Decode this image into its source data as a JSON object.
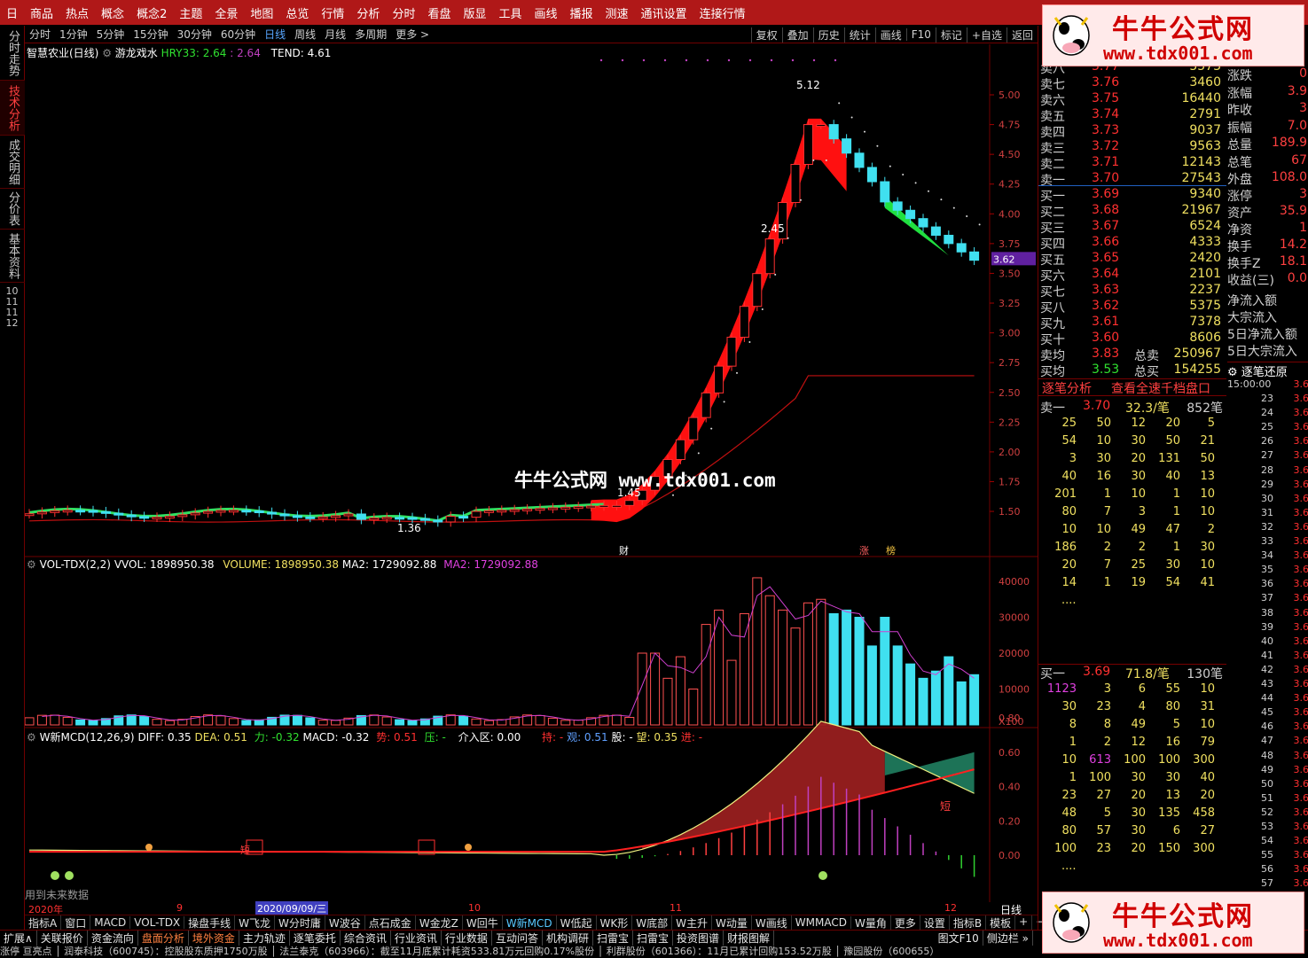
{
  "menu": [
    "日",
    "商品",
    "热点",
    "概念",
    "概念2",
    "主题",
    "全景",
    "地图",
    "总览",
    "行情",
    "分析",
    "分时",
    "看盘",
    "版显",
    "工具",
    "画线",
    "播报",
    "测速",
    "通讯设置",
    "连接行情"
  ],
  "periods": [
    "分时",
    "1分钟",
    "5分钟",
    "15分钟",
    "30分钟",
    "60分钟",
    "日线",
    "周线",
    "月线",
    "多周期",
    "更多 >"
  ],
  "period_active": "日线",
  "right_tools": [
    "复权",
    "叠加",
    "历史",
    "统计",
    "画线",
    "F10",
    "标记",
    "+自选",
    "返回"
  ],
  "left_tabs": [
    "分时走势",
    "技术分析",
    "成交明细",
    "分价表",
    "基本资料"
  ],
  "left_tab_active": "技术分析",
  "left_bottom_nums": [
    "10",
    "11",
    "11",
    "12"
  ],
  "main_legend": {
    "stock": "智慧农业(日线)",
    "indicator": "游龙戏水",
    "hry_label": "HRY33: 2.64",
    "hry_val2": "2.64",
    "tend": "TEND: 4.61"
  },
  "price_axis": [
    "5.00",
    "4.75",
    "4.50",
    "4.25",
    "4.00",
    "3.75",
    "3.50",
    "3.25",
    "3.00",
    "2.75",
    "2.50",
    "2.25",
    "2.00",
    "1.75",
    "1.50"
  ],
  "price_tag": "3.62",
  "annotations": {
    "high": "5.12",
    "low": "1.36",
    "mid1": "2.45",
    "mid2": "1.45",
    "cai": "财",
    "zhang": "涨",
    "bang": "榜"
  },
  "vol_legend": {
    "name": "VOL-TDX(2,2)",
    "vvol": "VVOL: 1898950.38",
    "volume": "VOLUME: 1898950.38",
    "ma2": "MA2: 1729092.88",
    "ma2b": "MA2: 1729092.88"
  },
  "vol_axis": [
    "40000",
    "30000",
    "20000",
    "10000",
    "X100"
  ],
  "macd_legend": {
    "name": "W新MCD(12,26,9)",
    "diff": "DIFF: 0.35",
    "dea": "DEA: 0.51",
    "li": "力: -0.32",
    "macd": "MACD: -0.32",
    "shi": "势: 0.51",
    "ya": "压: -",
    "jieru": "介入区: 0.00",
    "chi": "持: -",
    "guan": "观: 0.51",
    "gu": "股: -",
    "wang": "望: 0.35",
    "jin": "进: -"
  },
  "macd_axis": [
    "0.80",
    "0.60",
    "0.40",
    "0.20",
    "0.00"
  ],
  "macd_note": "用到未来数据",
  "macd_marks": {
    "duan": "短",
    "duan2": "短"
  },
  "date_axis": {
    "d2020": "2020年",
    "m9": "9",
    "cursor": "2020/09/09/三",
    "m10": "10",
    "m11": "11",
    "m12": "12",
    "period": "日线"
  },
  "center_watermark": "牛牛公式网 www.tdx001.com",
  "watermark": {
    "title": "牛牛公式网",
    "url": "www.tdx001.com"
  },
  "ind_tabs": [
    "指标A",
    "窗口",
    "MACD",
    "VOL-TDX",
    "操盘手线",
    "W飞龙",
    "W分时庸",
    "W波谷",
    "点石成金",
    "W金龙Z",
    "W回牛",
    "W新MCD",
    "W低起",
    "WK形",
    "W底部",
    "W主升",
    "W动量",
    "W画线",
    "WMMACD",
    "W量角",
    "更多",
    "设置"
  ],
  "ind_tab_active": "W新MCD",
  "ind_right": [
    "指标B",
    "模板",
    "+",
    "−"
  ],
  "bottom_tabs": [
    "扩展∧",
    "关联报价",
    "资金流向",
    "盘面分析",
    "境外资金",
    "主力轨迹",
    "逐笔委托",
    "综合资讯",
    "行业资讯",
    "行业数据",
    "互动问答",
    "机构调研",
    "扫雷宝",
    "扫雷宝",
    "投资图谱",
    "财报图解"
  ],
  "bottom_right": [
    "图文F10",
    "侧边栏 »"
  ],
  "ticker": "涨停 亘亮点 │ 润泰科技（600745）：控股股东质押1750万股 │ 法兰泰克（603966）：截至11月底累计耗资533.81万元回购0.17%股份 │ 利群股份（601366）：11月已累计回购153.52万股 │ 豫园股份（600655）",
  "order_book": {
    "asks": [
      {
        "label": "卖八",
        "price": "3.77",
        "vol": "5573"
      },
      {
        "label": "卖七",
        "price": "3.76",
        "vol": "3460"
      },
      {
        "label": "卖六",
        "price": "3.75",
        "vol": "16440"
      },
      {
        "label": "卖五",
        "price": "3.74",
        "vol": "2791"
      },
      {
        "label": "卖四",
        "price": "3.73",
        "vol": "9037"
      },
      {
        "label": "卖三",
        "price": "3.72",
        "vol": "9563"
      },
      {
        "label": "卖二",
        "price": "3.71",
        "vol": "12143"
      },
      {
        "label": "卖一",
        "price": "3.70",
        "vol": "27543"
      }
    ],
    "bids": [
      {
        "label": "买一",
        "price": "3.69",
        "vol": "9340"
      },
      {
        "label": "买二",
        "price": "3.68",
        "vol": "21967"
      },
      {
        "label": "买三",
        "price": "3.67",
        "vol": "6524"
      },
      {
        "label": "买四",
        "price": "3.66",
        "vol": "4333"
      },
      {
        "label": "买五",
        "price": "3.65",
        "vol": "2420"
      },
      {
        "label": "买六",
        "price": "3.64",
        "vol": "2101"
      },
      {
        "label": "买七",
        "price": "3.63",
        "vol": "2237"
      },
      {
        "label": "买八",
        "price": "3.62",
        "vol": "5375"
      },
      {
        "label": "买九",
        "price": "3.61",
        "vol": "7378"
      },
      {
        "label": "买十",
        "price": "3.60",
        "vol": "8606"
      }
    ],
    "avg_ask_label": "卖均",
    "avg_ask": "3.83",
    "total_ask_label": "总卖",
    "total_ask": "250967",
    "avg_bid_label": "买均",
    "avg_bid": "3.53",
    "total_bid_label": "总买",
    "total_bid": "154255"
  },
  "stats": [
    {
      "label": "涨跌",
      "value": "0"
    },
    {
      "label": "涨幅",
      "value": "3.9"
    },
    {
      "label": "昨收",
      "value": "3"
    },
    {
      "label": "振幅",
      "value": "7.0"
    },
    {
      "label": "总量",
      "value": "189.9"
    },
    {
      "label": "总笔",
      "value": "67"
    },
    {
      "label": "外盘",
      "value": "108.0"
    },
    {
      "label": "涨停",
      "value": "3"
    },
    {
      "label": "资产",
      "value": "35.9"
    },
    {
      "label": "净资",
      "value": "1"
    },
    {
      "label": "换手",
      "value": "14.2"
    },
    {
      "label": "换手Z",
      "value": "18.1"
    },
    {
      "label": "收益(三)",
      "value": "0.0"
    },
    {
      "label": "净流入额",
      "value": ""
    },
    {
      "label": "大宗流入",
      "value": ""
    },
    {
      "label": "5日净流入额",
      "value": ""
    },
    {
      "label": "5日大宗流入",
      "value": ""
    }
  ],
  "tick_section": {
    "title": "逐笔分析",
    "link": "查看全速千档盘口",
    "sell_label": "卖一",
    "sell_price": "3.70",
    "sell_avg": "32.3/笔",
    "sell_count": "852笔",
    "sell_rows": [
      [
        "25",
        "50",
        "12",
        "20",
        "5"
      ],
      [
        "54",
        "10",
        "30",
        "50",
        "21"
      ],
      [
        "3",
        "30",
        "20",
        "131",
        "50"
      ],
      [
        "40",
        "16",
        "30",
        "40",
        "13"
      ],
      [
        "201",
        "1",
        "10",
        "1",
        "10"
      ],
      [
        "80",
        "7",
        "3",
        "1",
        "10"
      ],
      [
        "10",
        "10",
        "49",
        "47",
        "2"
      ],
      [
        "186",
        "2",
        "2",
        "1",
        "30"
      ],
      [
        "20",
        "7",
        "25",
        "30",
        "10"
      ],
      [
        "14",
        "1",
        "19",
        "54",
        "41"
      ]
    ],
    "buy_label": "买一",
    "buy_price": "3.69",
    "buy_avg": "71.8/笔",
    "buy_count": "130笔",
    "buy_rows": [
      [
        "1123",
        "3",
        "6",
        "55",
        "10"
      ],
      [
        "30",
        "23",
        "4",
        "80",
        "31"
      ],
      [
        "8",
        "8",
        "49",
        "5",
        "10"
      ],
      [
        "1",
        "2",
        "12",
        "16",
        "79"
      ],
      [
        "10",
        "613",
        "100",
        "100",
        "300"
      ],
      [
        "1",
        "100",
        "30",
        "30",
        "40"
      ],
      [
        "23",
        "27",
        "20",
        "13",
        "20"
      ],
      [
        "48",
        "5",
        "30",
        "135",
        "458"
      ],
      [
        "80",
        "57",
        "30",
        "6",
        "27"
      ],
      [
        "100",
        "23",
        "20",
        "150",
        "300"
      ]
    ],
    "ellipsis": "...."
  },
  "time_sales": {
    "title": "逐笔还原",
    "time": "15:00:00",
    "minutes": [
      "23",
      "24",
      "25",
      "26",
      "27",
      "28",
      "29",
      "30",
      "31",
      "32",
      "33",
      "34",
      "35",
      "36",
      "37",
      "38",
      "39",
      "40",
      "41",
      "42",
      "43",
      "44",
      "45",
      "46",
      "47",
      "48",
      "49",
      "50",
      "51",
      "52",
      "53",
      "54",
      "55",
      "56",
      "57"
    ],
    "price": "3.6"
  }
}
